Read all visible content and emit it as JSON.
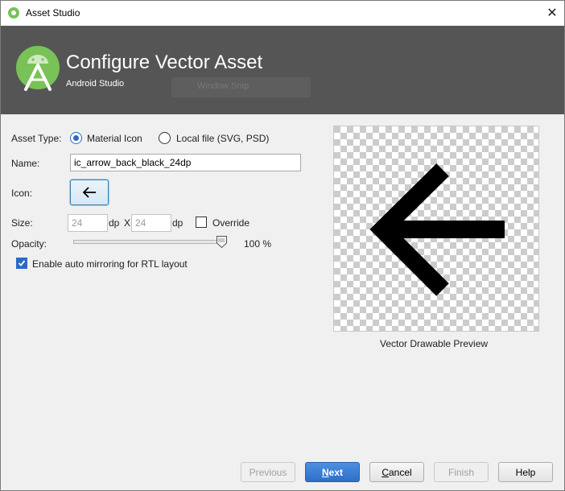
{
  "window": {
    "title": "Asset Studio",
    "close_glyph": "✕"
  },
  "banner": {
    "heading": "Configure Vector Asset",
    "subheading": "Android Studio",
    "overlay_text": "Window Snip"
  },
  "form": {
    "asset_type_label": "Asset Type:",
    "asset_type_options": [
      "Material Icon",
      "Local file (SVG, PSD)"
    ],
    "asset_type_selected": "Material Icon",
    "name_label": "Name:",
    "name_value": "ic_arrow_back_black_24dp",
    "icon_label": "Icon:",
    "size_label": "Size:",
    "width_value": "24",
    "height_value": "24",
    "dp_unit": "dp",
    "x_separator": "X",
    "override_label": "Override",
    "override_checked": false,
    "opacity_label": "Opacity:",
    "opacity_percent": 100,
    "opacity_text": "100 %",
    "mirroring_label": "Enable auto mirroring for RTL layout",
    "mirroring_checked": true
  },
  "preview": {
    "caption": "Vector Drawable Preview",
    "icon": "arrow-back-icon"
  },
  "footer": {
    "previous": "Previous",
    "next_prefix": "N",
    "next_rest": "ext",
    "cancel_prefix": "C",
    "cancel_rest": "ancel",
    "finish": "Finish",
    "help": "Help"
  },
  "colors": {
    "banner_bg": "#555555",
    "accent": "#2b69c5",
    "android_green": "#78c257"
  }
}
